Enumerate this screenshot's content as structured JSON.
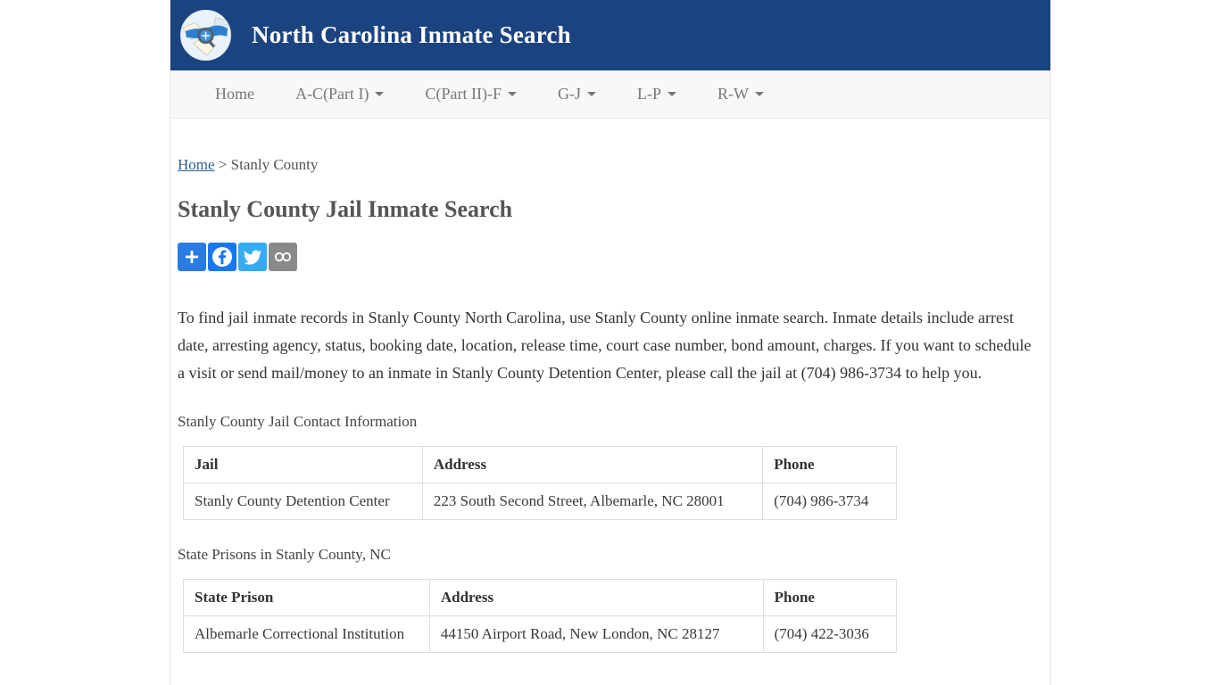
{
  "header": {
    "title": "North Carolina Inmate Search",
    "logo_icon": "nc-map-magnifier-icon",
    "bg_color": "#1b4380"
  },
  "nav": {
    "items": [
      {
        "label": "Home",
        "has_caret": false
      },
      {
        "label": "A-C(Part I)",
        "has_caret": true
      },
      {
        "label": "C(Part II)-F",
        "has_caret": true
      },
      {
        "label": "G-J",
        "has_caret": true
      },
      {
        "label": "L-P",
        "has_caret": true
      },
      {
        "label": "R-W",
        "has_caret": true
      }
    ]
  },
  "breadcrumb": {
    "home_label": "Home",
    "separator": ">",
    "current": "Stanly County"
  },
  "main": {
    "page_title": "Stanly County Jail Inmate Search",
    "intro_paragraph": "To find jail inmate records in Stanly County North Carolina, use Stanly County online inmate search. Inmate details include arrest date, arresting agency, status, booking date, location, release time, court case number, bond amount, charges. If you want to schedule a visit or send mail/money to an inmate in Stanly County Detention Center, please call the jail at (704) 986-3734 to help you.",
    "jail_section_label": "Stanly County Jail Contact Information",
    "prison_section_label": "State Prisons in Stanly County, NC"
  },
  "share": {
    "buttons": [
      {
        "name": "addthis-share-button",
        "icon": "plus-icon",
        "color": "#2b7be4"
      },
      {
        "name": "facebook-share-button",
        "icon": "facebook-icon",
        "color": "#1877f2"
      },
      {
        "name": "twitter-share-button",
        "icon": "twitter-bird-icon",
        "color": "#35aaf5"
      },
      {
        "name": "copy-link-button",
        "icon": "chain-link-icon",
        "color": "#8a8a8a"
      }
    ]
  },
  "jail_table": {
    "headers": [
      "Jail",
      "Address",
      "Phone"
    ],
    "rows": [
      [
        "Stanly County Detention Center",
        "223 South Second Street, Albemarle, NC 28001",
        "(704) 986-3734"
      ]
    ]
  },
  "prison_table": {
    "headers": [
      "State Prison",
      "Address",
      "Phone"
    ],
    "rows": [
      [
        "Albemarle Correctional Institution",
        "44150 Airport Road, New London, NC 28127",
        "(704) 422-3036"
      ]
    ]
  }
}
